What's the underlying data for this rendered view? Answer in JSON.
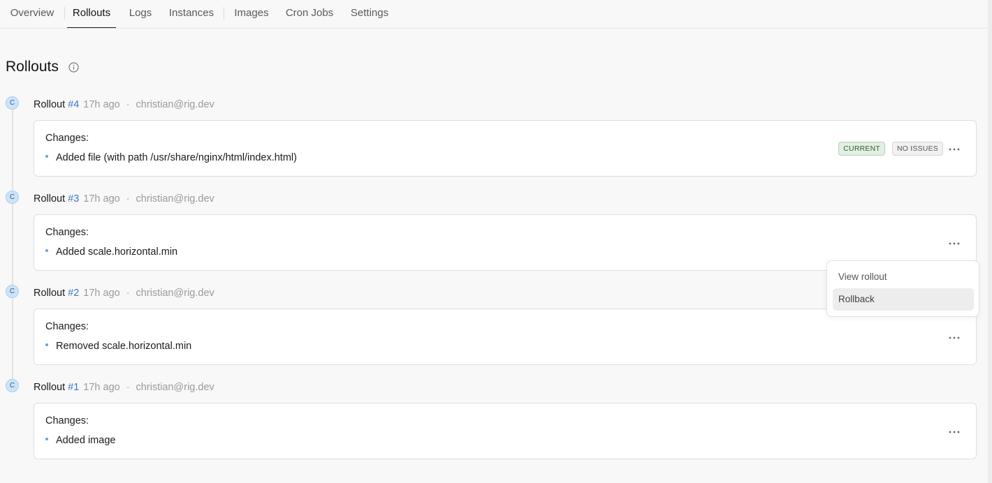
{
  "tabs": [
    {
      "label": "Overview"
    },
    {
      "label": "Rollouts"
    },
    {
      "label": "Logs"
    },
    {
      "label": "Instances"
    },
    {
      "label": "Images"
    },
    {
      "label": "Cron Jobs"
    },
    {
      "label": "Settings"
    }
  ],
  "active_tab": "Rollouts",
  "page": {
    "title": "Rollouts"
  },
  "rollouts": [
    {
      "avatar": "C",
      "label": "Rollout",
      "number": "#4",
      "age": "17h ago",
      "separator": "·",
      "author": "christian@rig.dev",
      "changes_label": "Changes:",
      "change": "Added file (with path /usr/share/nginx/html/index.html)",
      "badges": [
        "CURRENT",
        "NO ISSUES"
      ]
    },
    {
      "avatar": "C",
      "label": "Rollout",
      "number": "#3",
      "age": "17h ago",
      "separator": "·",
      "author": "christian@rig.dev",
      "changes_label": "Changes:",
      "change": "Added scale.horizontal.min"
    },
    {
      "avatar": "C",
      "label": "Rollout",
      "number": "#2",
      "age": "17h ago",
      "separator": "·",
      "author": "christian@rig.dev",
      "changes_label": "Changes:",
      "change": "Removed scale.horizontal.min"
    },
    {
      "avatar": "C",
      "label": "Rollout",
      "number": "#1",
      "age": "17h ago",
      "separator": "·",
      "author": "christian@rig.dev",
      "changes_label": "Changes:",
      "change": "Added image"
    }
  ],
  "menu": {
    "items": [
      {
        "label": "View rollout"
      },
      {
        "label": "Rollback"
      }
    ],
    "hovered": "Rollback"
  },
  "colors": {
    "link": "#3c78c6",
    "badge_current_bg": "#e2efe3",
    "avatar_bg": "#cfe3f7"
  }
}
